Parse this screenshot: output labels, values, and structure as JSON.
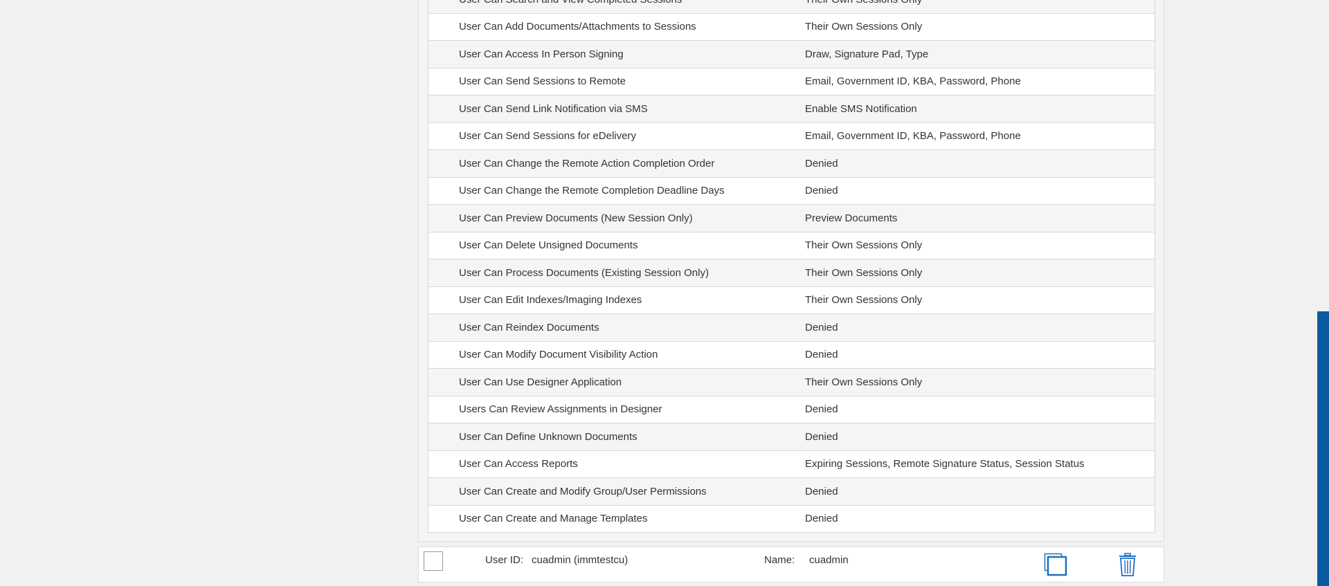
{
  "permissions": [
    {
      "name": "User Can Search and View Completed Sessions",
      "value": "Their Own Sessions Only"
    },
    {
      "name": "User Can Add Documents/Attachments to Sessions",
      "value": "Their Own Sessions Only"
    },
    {
      "name": "User Can Access In Person Signing",
      "value": "Draw, Signature Pad, Type"
    },
    {
      "name": "User Can Send Sessions to Remote",
      "value": "Email, Government ID, KBA, Password, Phone"
    },
    {
      "name": "User Can Send Link Notification via SMS",
      "value": "Enable SMS Notification"
    },
    {
      "name": "User Can Send Sessions for eDelivery",
      "value": "Email, Government ID, KBA, Password, Phone"
    },
    {
      "name": "User Can Change the Remote Action Completion Order",
      "value": "Denied"
    },
    {
      "name": "User Can Change the Remote Completion Deadline Days",
      "value": "Denied"
    },
    {
      "name": "User Can Preview Documents (New Session Only)",
      "value": "Preview Documents"
    },
    {
      "name": "User Can Delete Unsigned Documents",
      "value": "Their Own Sessions Only"
    },
    {
      "name": "User Can Process Documents (Existing Session Only)",
      "value": "Their Own Sessions Only"
    },
    {
      "name": "User Can Edit Indexes/Imaging Indexes",
      "value": "Their Own Sessions Only"
    },
    {
      "name": "User Can Reindex Documents",
      "value": "Denied"
    },
    {
      "name": "User Can Modify Document Visibility Action",
      "value": "Denied"
    },
    {
      "name": "User Can Use Designer Application",
      "value": "Their Own Sessions Only"
    },
    {
      "name": "Users Can Review Assignments in Designer",
      "value": "Denied"
    },
    {
      "name": "User Can Define Unknown Documents",
      "value": "Denied"
    },
    {
      "name": "User Can Access Reports",
      "value": "Expiring Sessions, Remote Signature Status, Session Status"
    },
    {
      "name": "User Can Create and Modify Group/User Permissions",
      "value": "Denied"
    },
    {
      "name": "User Can Create and Manage Templates",
      "value": "Denied"
    }
  ],
  "user_bar": {
    "user_id_label": "User ID:",
    "user_id_value": "cuadmin (immtestcu)",
    "name_label": "Name:",
    "name_value": "cuadmin",
    "copy_icon": "copy-icon",
    "delete_icon": "trash-icon"
  },
  "colors": {
    "accent": "#0a5aa0",
    "icon_blue": "#1f6fc0"
  }
}
